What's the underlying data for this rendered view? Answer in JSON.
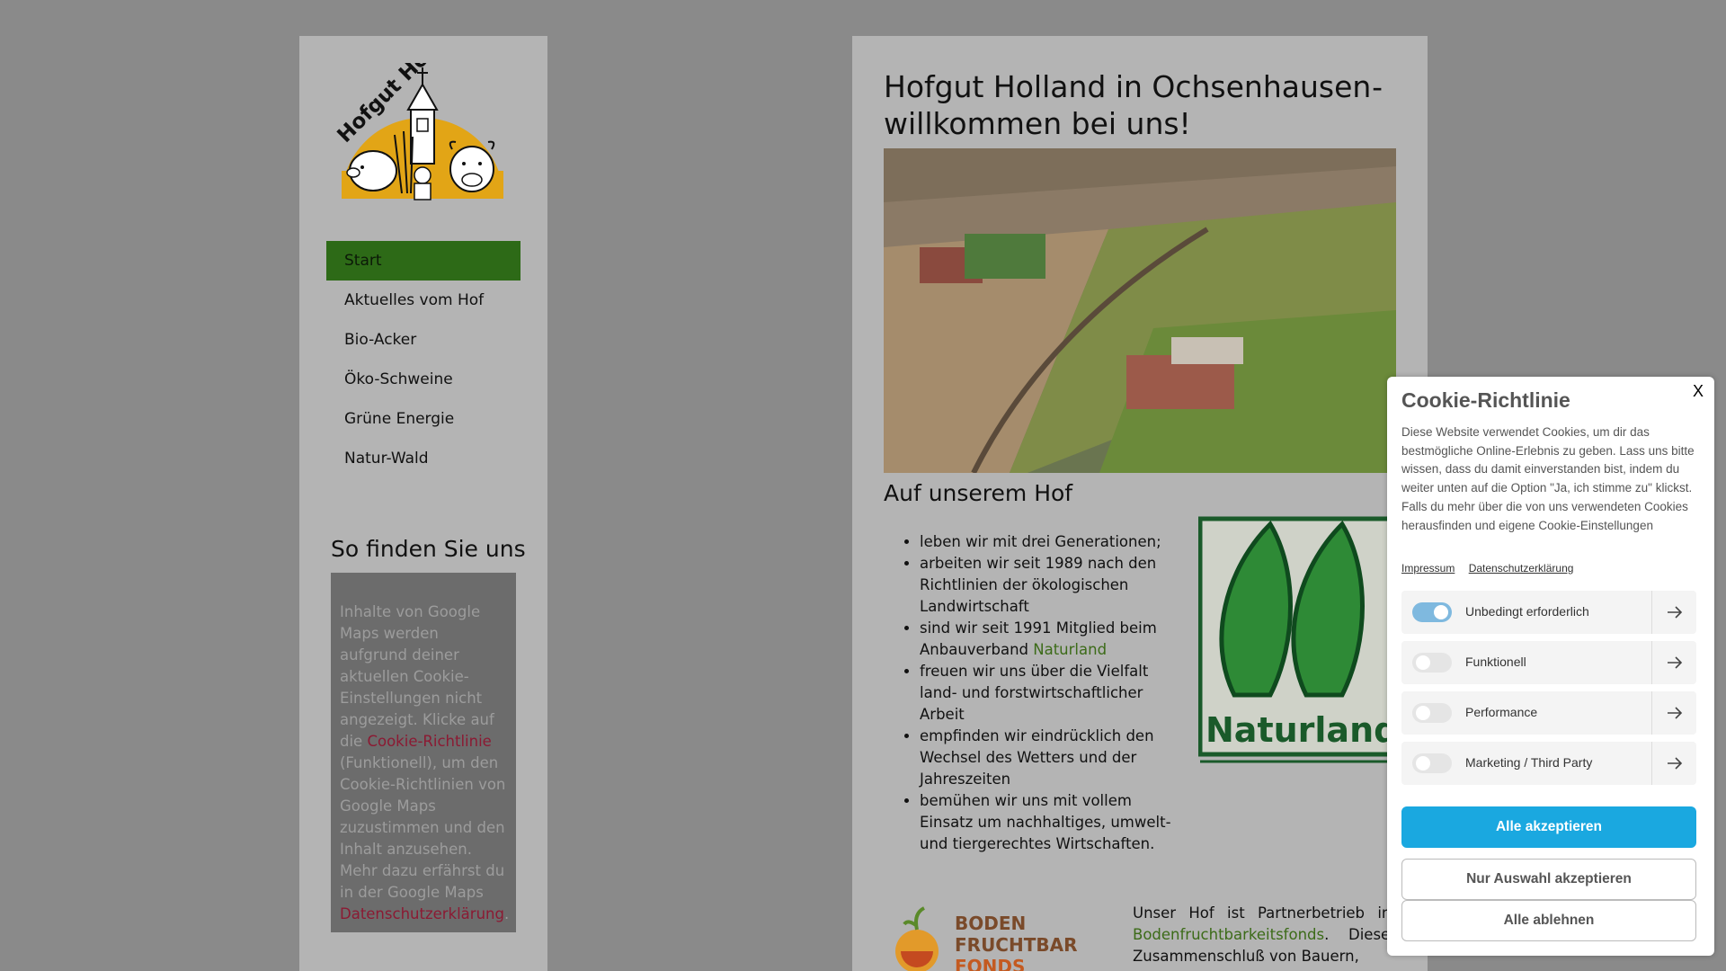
{
  "logo": {
    "text": "Hofgut Holland",
    "colors": {
      "sun": "#e2a516",
      "ink": "#111111"
    }
  },
  "nav": {
    "items": [
      {
        "label": "Start",
        "active": true
      },
      {
        "label": "Aktuelles vom Hof"
      },
      {
        "label": "Bio-Acker"
      },
      {
        "label": "Öko-Schweine"
      },
      {
        "label": "Grüne Energie"
      },
      {
        "label": "Natur-Wald"
      }
    ]
  },
  "find_us": {
    "title": "So finden Sie uns",
    "text_1": "Inhalte von Google Maps werden aufgrund deiner aktuellen Cookie-Einstellungen nicht angezeigt. Klicke auf die ",
    "link_1": "Cookie-Richtlinie",
    "text_2": " (Funktionell), um den Cookie-Richtlinien von Google Maps zuzustimmen und den Inhalt anzusehen. Mehr dazu erfährst du in der Google Maps ",
    "link_2": "Datenschutzerklärung",
    "text_3": "."
  },
  "main": {
    "title": "Hofgut Holland in Ochsenhausen willkommen bei uns!",
    "title_dash": "-",
    "subtitle": "Auf unserem Hof",
    "facts": [
      {
        "text": "leben wir mit drei Generationen;"
      },
      {
        "text": "arbeiten wir seit 1989 nach den Richtlinien der ökologischen Landwirtschaft"
      },
      {
        "text": "sind wir seit 1991 Mitglied beim Anbauverband ",
        "link": "Naturland"
      },
      {
        "text": "freuen wir uns über die Vielfalt land- und forstwirtschaftlicher Arbeit"
      },
      {
        "text": "empfinden wir eindrücklich den Wechsel des Wetters und der Jahreszeiten"
      },
      {
        "text": "bemühen wir uns mit vollem Einsatz um nachhaltiges, umwelt- und tiergerechtes Wirtschaften."
      }
    ],
    "naturland_logo": "Naturland",
    "boden_logo": {
      "line1": "BODEN",
      "line2": "FRUCHTBARKEIT",
      "line3": "FONDS"
    },
    "partner_text_1": "Unser Hof ist Partnerbetrieb im ",
    "partner_link": "Bodenfruchtbarkeitsfonds",
    "partner_text_2": ". Dieser Zusammenschluß von Bauern,"
  },
  "cookie": {
    "close": "X",
    "title": "Cookie-Richtlinie",
    "text": "Diese Website verwendet Cookies, um dir das bestmögliche Online-Erlebnis zu geben. Lass uns bitte wissen, dass du damit einverstanden bist, indem du weiter unten auf die Option \"Ja, ich stimme zu\" klickst. Falls du mehr über die von uns verwendeten Cookies herausfinden und eigene Cookie-Einstellungen verwenden möchtest, schau",
    "links": {
      "impressum": "Impressum",
      "datenschutz": "Datenschutzerklärung"
    },
    "categories": [
      {
        "label": "Unbedingt erforderlich",
        "on": true
      },
      {
        "label": "Funktionell",
        "on": false
      },
      {
        "label": "Performance",
        "on": false
      },
      {
        "label": "Marketing / Third Party",
        "on": false
      }
    ],
    "accept_all": "Alle akzeptieren",
    "accept_selection": "Nur Auswahl akzeptieren",
    "reject_all": "Alle ablehnen",
    "colors": {
      "primary": "#1aa8e0",
      "toggle_on": "#7fb9df"
    }
  }
}
